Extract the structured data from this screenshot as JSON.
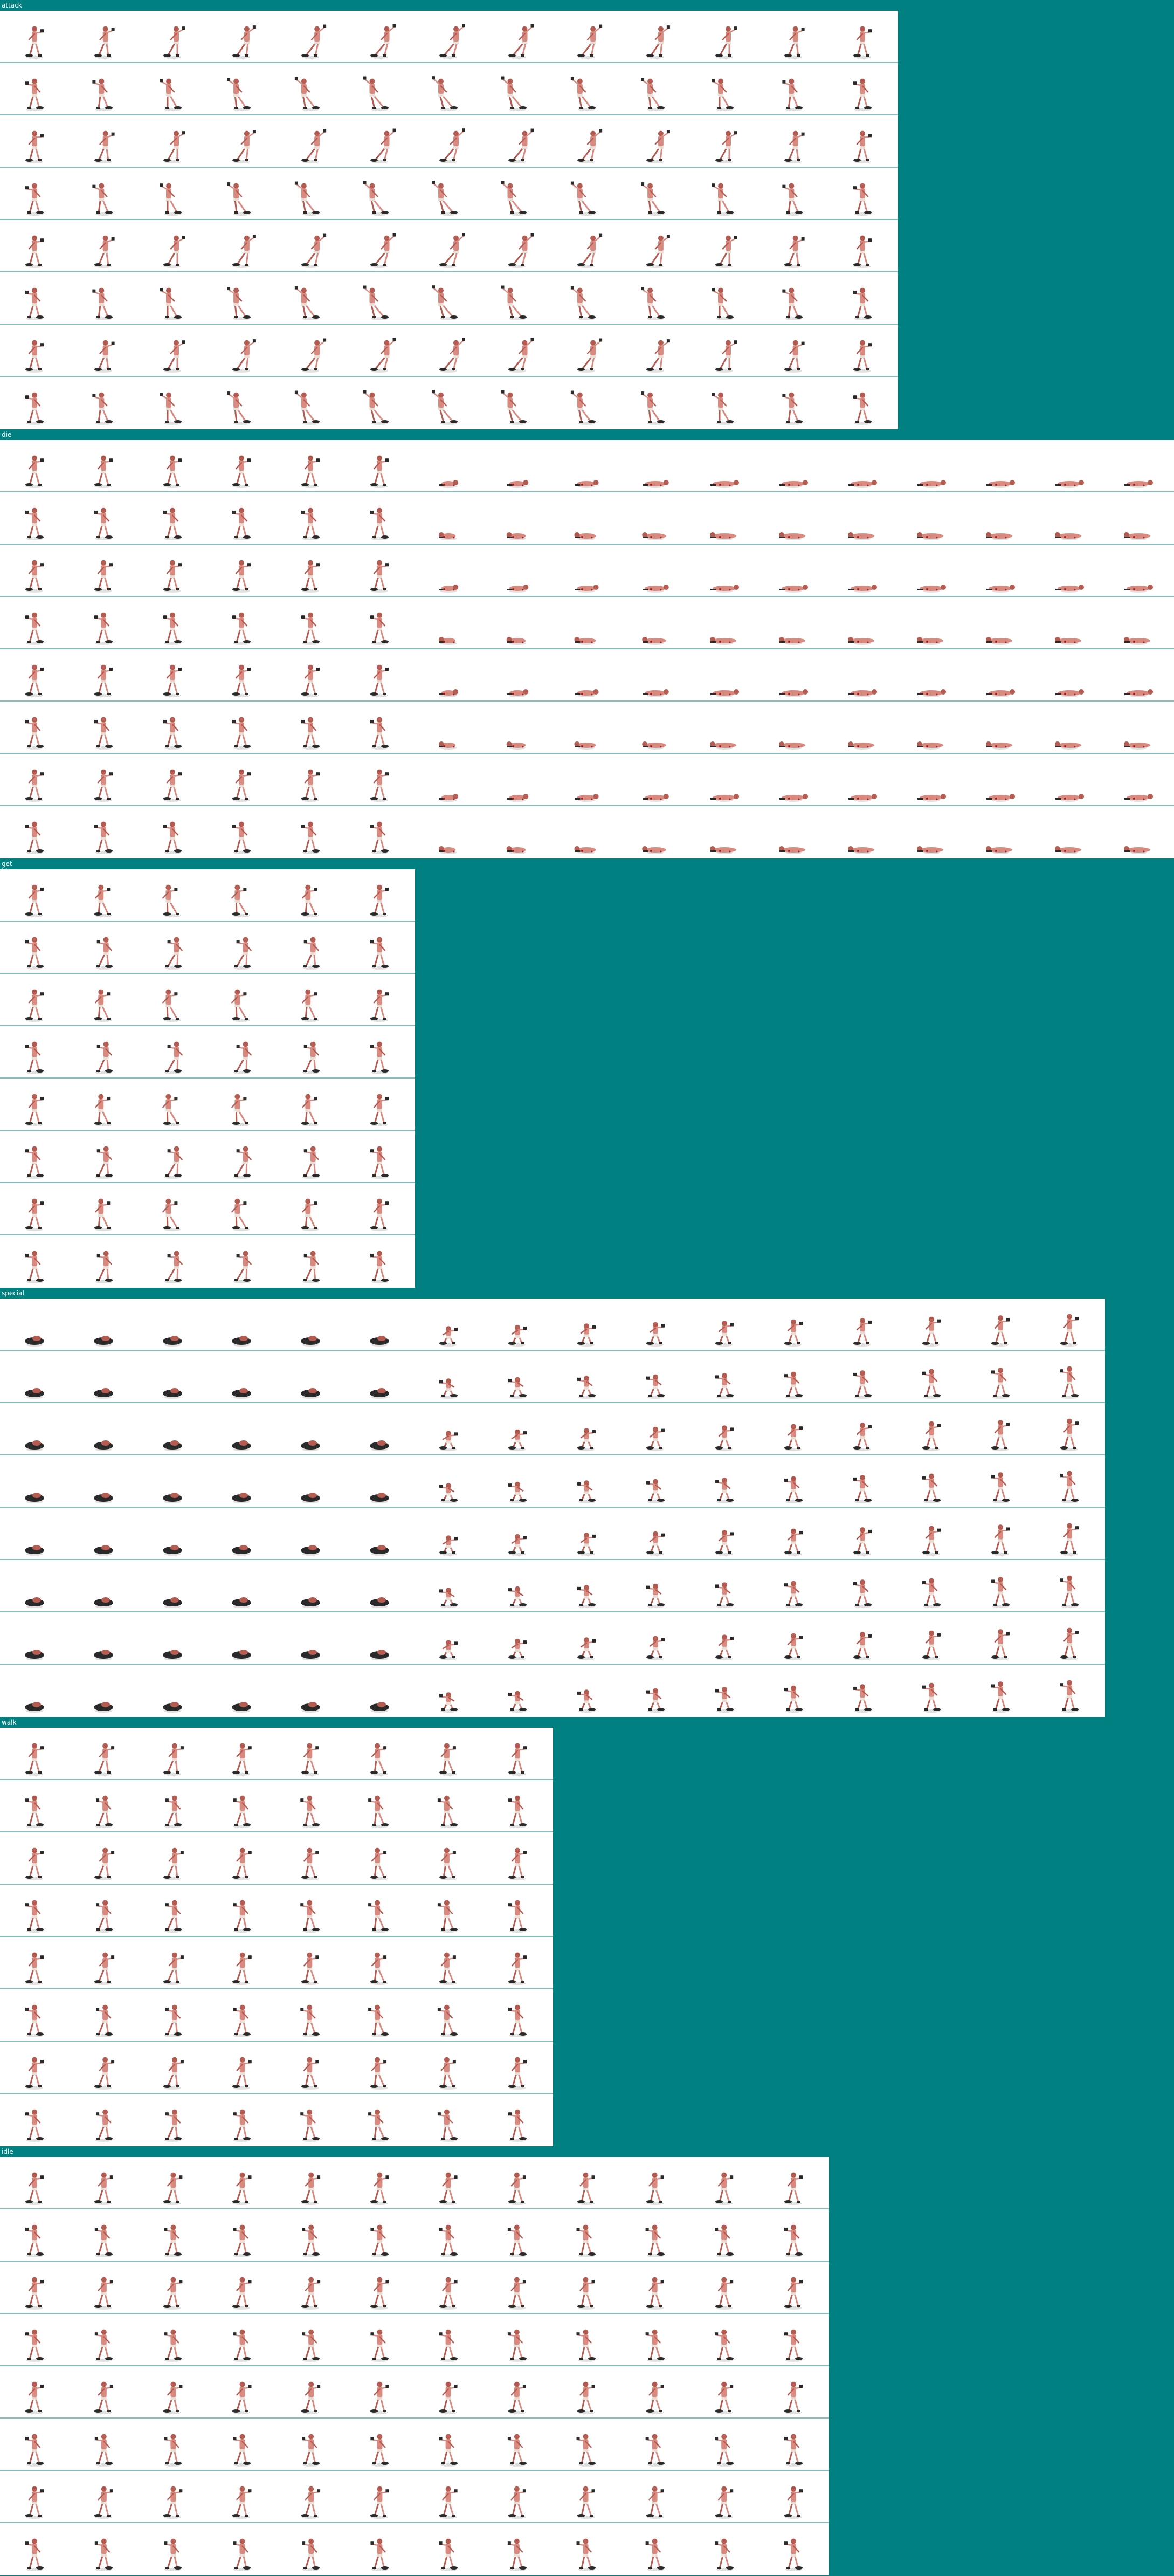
{
  "sheet": {
    "background_color": "#008080",
    "row_separator_color": "#7fbfbf",
    "frame_background_color": "#ffffff",
    "sprite_colors": {
      "skin": "#d98a80",
      "skin_shadow": "#b45c52",
      "dark": "#2a2a2a",
      "cloth": "#e8e0d8",
      "blood": "#a02020"
    },
    "sections": [
      {
        "key": "attack",
        "label": "attack",
        "rows": 8,
        "frames": 13,
        "pose": "attack-pose"
      },
      {
        "key": "die",
        "label": "die",
        "rows": 8,
        "frames": 17,
        "pose": "die-pose"
      },
      {
        "key": "get_hit",
        "label": "get hit",
        "rows": 8,
        "frames": 6,
        "pose": "get-hit-pose"
      },
      {
        "key": "special",
        "label": "special",
        "rows": 8,
        "frames": 16,
        "pose": "special-pose"
      },
      {
        "key": "walk",
        "label": "walk",
        "rows": 8,
        "frames": 8,
        "pose": "walk-pose"
      },
      {
        "key": "idle",
        "label": "idle",
        "rows": 8,
        "frames": 12,
        "pose": "idle-pose"
      }
    ]
  }
}
